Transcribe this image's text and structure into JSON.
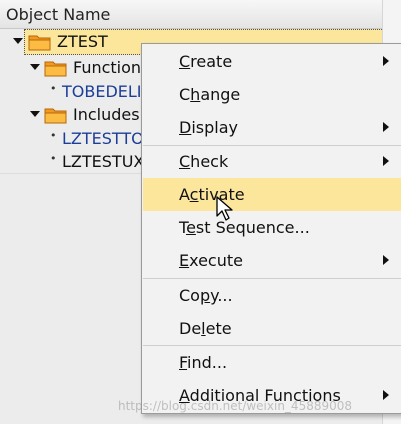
{
  "tree": {
    "header": "Object Name",
    "nodes": [
      {
        "label": "ZTEST",
        "type": "folder",
        "expanded": true
      },
      {
        "label": "Function",
        "type": "folder",
        "expanded": true
      },
      {
        "label": "TOBEDELI",
        "type": "link"
      },
      {
        "label": "Includes",
        "type": "folder",
        "expanded": true
      },
      {
        "label": "LZTESTTO",
        "type": "link"
      },
      {
        "label": "LZTESTUX",
        "type": "plain"
      }
    ]
  },
  "context_menu": {
    "items": [
      {
        "label": "Create",
        "submenu": true
      },
      {
        "label": "Change",
        "submenu": false
      },
      {
        "label": "Display",
        "submenu": true
      },
      {
        "label": "Check",
        "submenu": true
      },
      {
        "label": "Activate",
        "submenu": false,
        "highlighted": true
      },
      {
        "label": "Test Sequence...",
        "submenu": false
      },
      {
        "label": "Execute",
        "submenu": true
      },
      {
        "label": "Copy...",
        "submenu": false
      },
      {
        "label": "Delete",
        "submenu": false
      },
      {
        "label": "Find...",
        "submenu": false
      },
      {
        "label": "Additional Functions",
        "submenu": true
      }
    ]
  },
  "watermark": "https://blog.csdn.net/weixin_45889008",
  "colors": {
    "highlight": "#fbe69b",
    "link": "#1b3e98",
    "folder": "#f39a1e"
  }
}
